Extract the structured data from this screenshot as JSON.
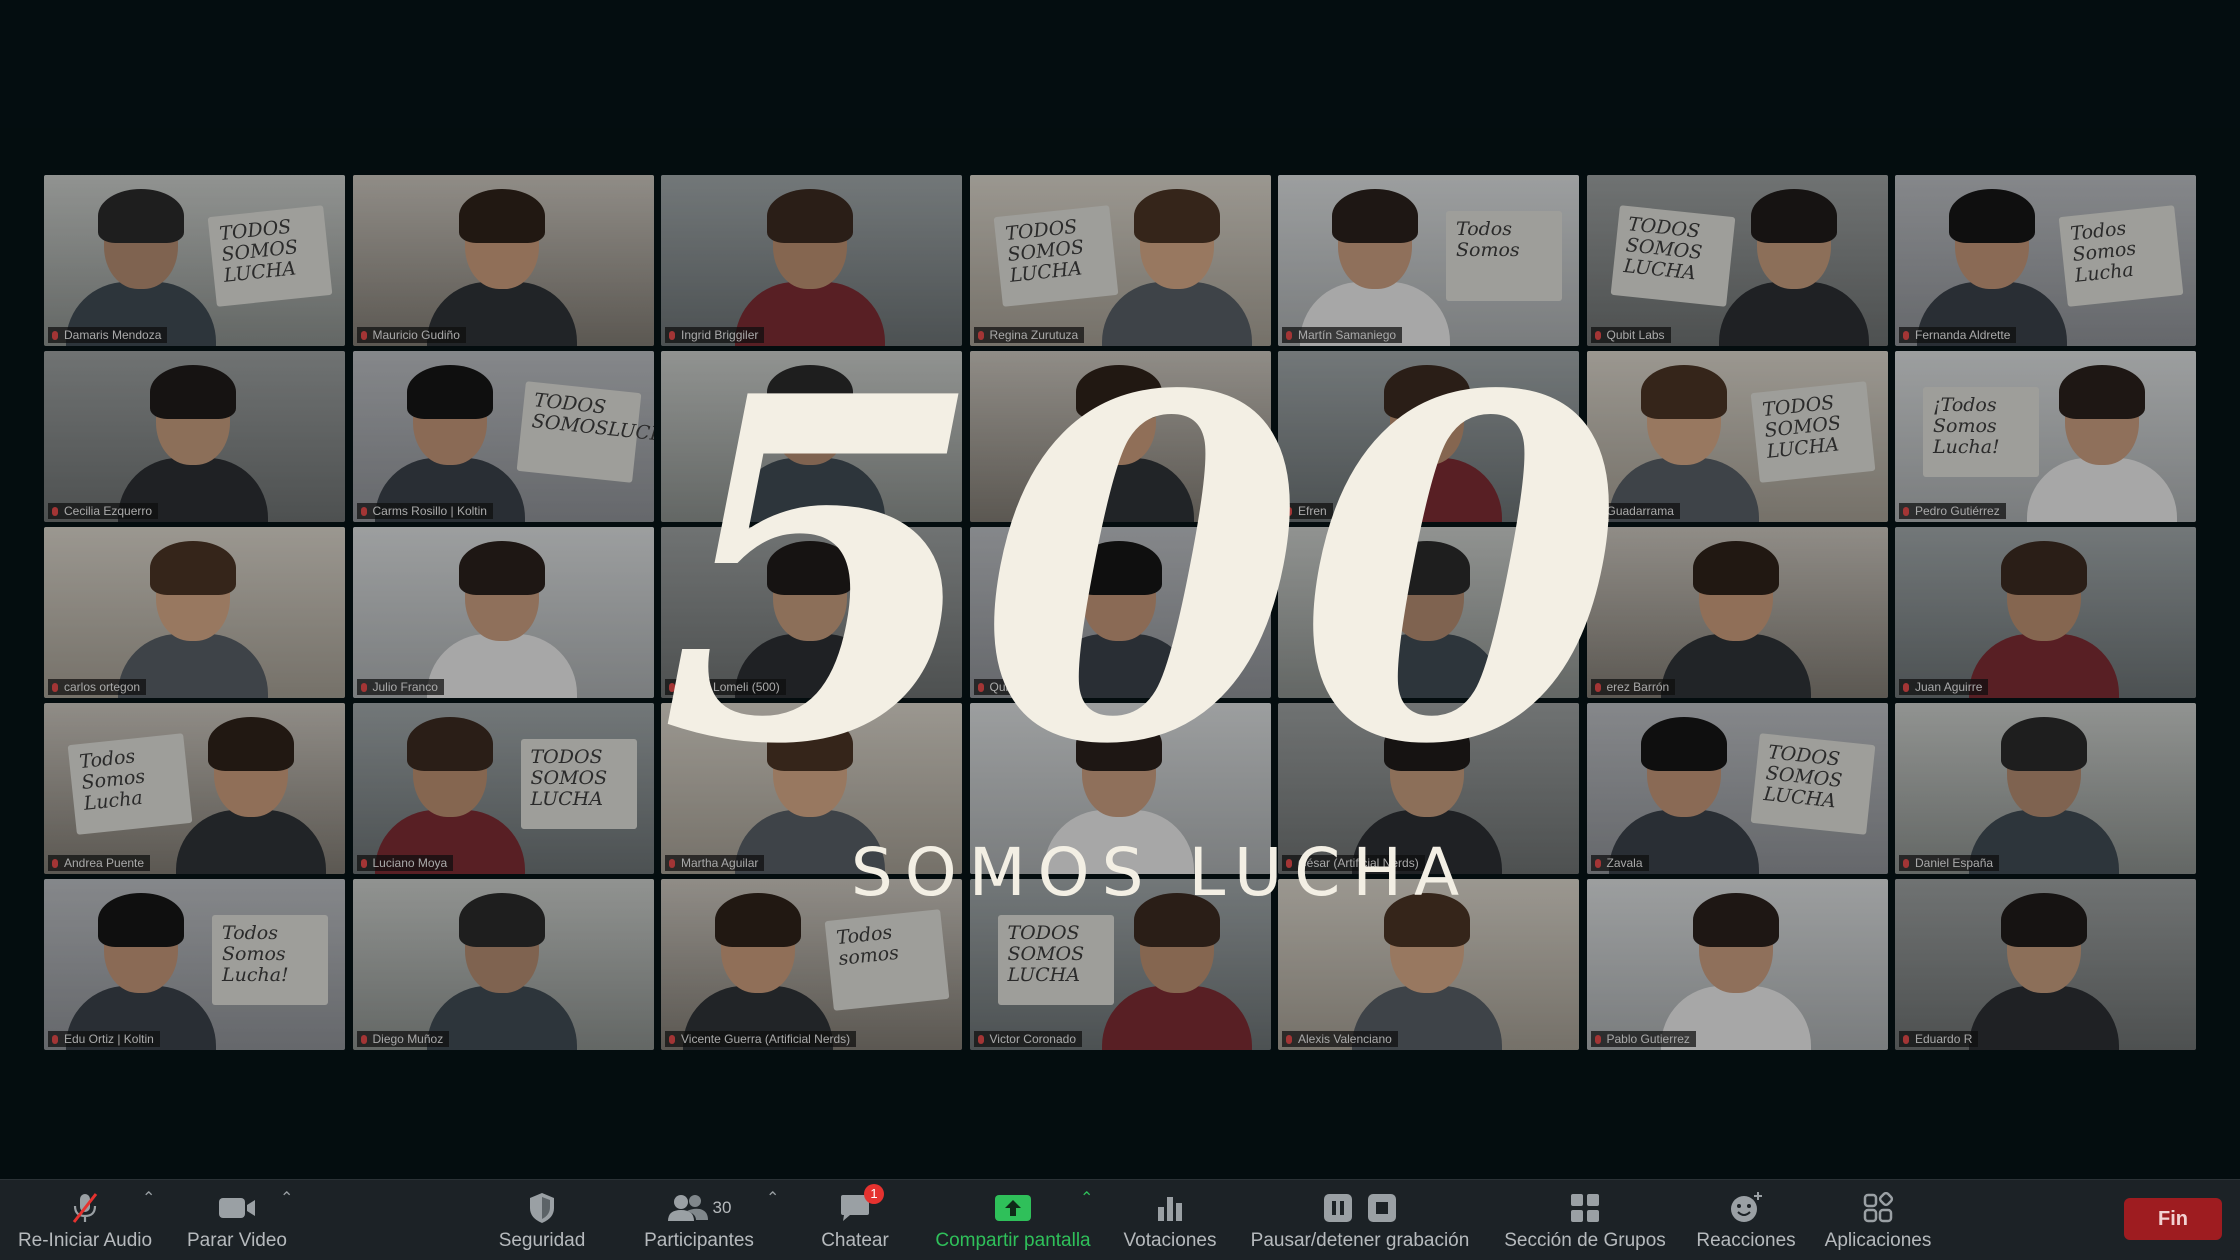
{
  "overlay": {
    "number": "500",
    "subtitle": "SOMOS LUCHA"
  },
  "participants": [
    {
      "name": "Damaris Mendoza",
      "sign": "TODOS SOMOS LUCHA"
    },
    {
      "name": "Mauricio Gudiño",
      "sign": ""
    },
    {
      "name": "Ingrid Briggiler",
      "sign": ""
    },
    {
      "name": "Regina Zurutuza",
      "sign": "TODOS SOMOS LUCHA"
    },
    {
      "name": "Martín Samaniego",
      "sign": "Todos Somos"
    },
    {
      "name": "Qubit Labs",
      "sign": "TODOS SOMOS LUCHA"
    },
    {
      "name": "Fernanda Aldrette",
      "sign": "Todos Somos Lucha"
    },
    {
      "name": "Cecilia Ezquerro",
      "sign": ""
    },
    {
      "name": "Carms Rosillo | Koltin",
      "sign": "TODOS SOMOSLUCHA"
    },
    {
      "name": "",
      "sign": ""
    },
    {
      "name": "",
      "sign": ""
    },
    {
      "name": "Efren",
      "sign": ""
    },
    {
      "name": "Guadarrama",
      "sign": "TODOS SOMOS LUCHA"
    },
    {
      "name": "Pedro Gutiérrez",
      "sign": "¡Todos Somos Lucha!"
    },
    {
      "name": "carlos ortegon",
      "sign": ""
    },
    {
      "name": "Julio Franco",
      "sign": ""
    },
    {
      "name": "Rene Lomeli (500)",
      "sign": ""
    },
    {
      "name": "Quiroz",
      "sign": ""
    },
    {
      "name": "",
      "sign": ""
    },
    {
      "name": "erez Barrón",
      "sign": ""
    },
    {
      "name": "Juan Aguirre",
      "sign": ""
    },
    {
      "name": "Andrea Puente",
      "sign": "Todos Somos Lucha"
    },
    {
      "name": "Luciano Moya",
      "sign": "TODOS SOMOS LUCHA"
    },
    {
      "name": "Martha Aguilar",
      "sign": ""
    },
    {
      "name": "",
      "sign": ""
    },
    {
      "name": "César (Artificial Nerds)",
      "sign": ""
    },
    {
      "name": "Zavala",
      "sign": "TODOS SOMOS LUCHA"
    },
    {
      "name": "Daniel España",
      "sign": ""
    },
    {
      "name": "Edu Ortiz | Koltin",
      "sign": "Todos Somos Lucha!"
    },
    {
      "name": "Diego Muñoz",
      "sign": ""
    },
    {
      "name": "Vicente Guerra (Artificial Nerds)",
      "sign": "Todos somos"
    },
    {
      "name": "Victor Coronado",
      "sign": "TODOS SOMOS LUCHA"
    },
    {
      "name": "Alexis Valenciano",
      "sign": ""
    },
    {
      "name": "Pablo Gutierrez",
      "sign": ""
    },
    {
      "name": "Eduardo R",
      "sign": ""
    }
  ],
  "toolbar": {
    "audio_label": "Re-Iniciar Audio",
    "video_label": "Parar Video",
    "security_label": "Seguridad",
    "participants_label": "Participantes",
    "participants_count": "30",
    "chat_label": "Chatear",
    "chat_badge": "1",
    "share_label": "Compartir pantalla",
    "polls_label": "Votaciones",
    "recording_label": "Pausar/detener grabación",
    "breakout_label": "Sección de Grupos",
    "reactions_label": "Reacciones",
    "apps_label": "Aplicaciones",
    "end_label": "Fin"
  },
  "colors": {
    "background": "#061216",
    "toolbar": "#1c2226",
    "share_green": "#2fc05a",
    "end_red": "#9e1c20",
    "overlay_text": "#f3efe4"
  }
}
